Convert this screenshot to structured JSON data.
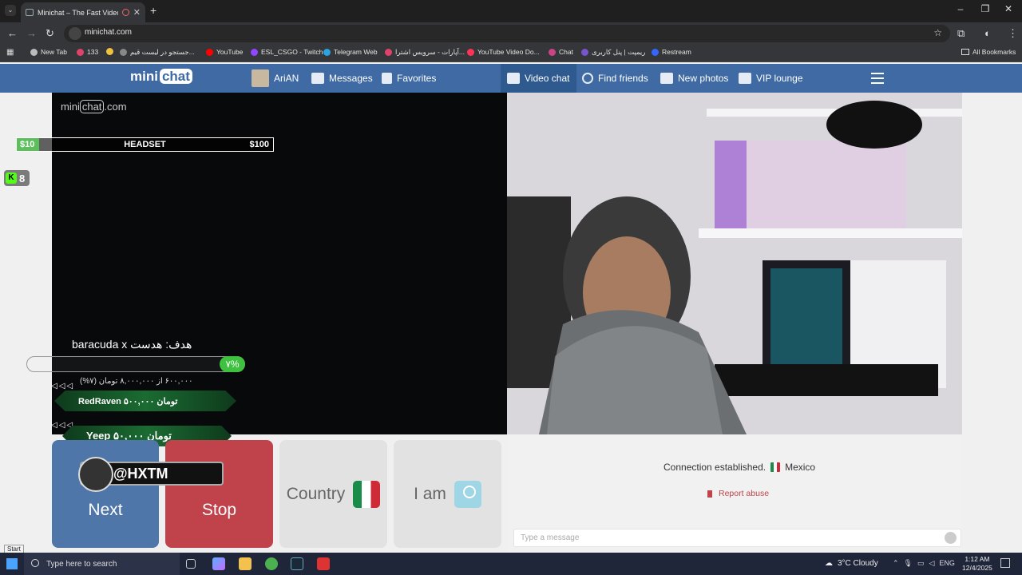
{
  "browser": {
    "tab_title": "Minichat – The Fast Video C",
    "url": "minichat.com",
    "bookmarks": [
      {
        "label": "New Tab",
        "color": "#bbbbbb"
      },
      {
        "label": "133",
        "color": "#e0426a"
      },
      {
        "label": "",
        "color": "#f0c040"
      },
      {
        "label": "جستجو در لیست قیم...",
        "color": "#888888"
      },
      {
        "label": "YouTube",
        "color": "#ff0000"
      },
      {
        "label": "ESL_CSGO - Twitch",
        "color": "#9146ff"
      },
      {
        "label": "Telegram Web",
        "color": "#2aa3e0"
      },
      {
        "label": "آپارات - سرویس اشترا...",
        "color": "#e0426a"
      },
      {
        "label": "YouTube Video Do...",
        "color": "#ff3355"
      },
      {
        "label": "Chat",
        "color": "#cc4488"
      },
      {
        "label": "ریمپت | پنل کاربری",
        "color": "#7755cc"
      },
      {
        "label": "Restream",
        "color": "#3366ff"
      }
    ],
    "all_bookmarks_label": "All Bookmarks"
  },
  "site": {
    "logo_mini": "mini",
    "logo_chat": "chat",
    "nav": {
      "user": "AriAN",
      "messages": "Messages",
      "favorites": "Favorites",
      "video_chat": "Video chat",
      "find_friends": "Find friends",
      "new_photos": "New photos",
      "vip_lounge": "VIP lounge"
    },
    "watermark_mini": "mini",
    "watermark_chat": "chat",
    "watermark_com": ".com"
  },
  "overlay": {
    "goal_low": "$10",
    "goal_label": "HEADSET",
    "goal_high": "$100",
    "kick_count": "8",
    "donation_title": "هدف: هدست baracuda x",
    "donation_percent_label": "۷%",
    "donation_progress": 0.07,
    "donation_sub": "۶۰۰,۰۰۰ از ۸,۰۰۰,۰۰۰ تومان (۷%)",
    "alert1": "RedRaven  ۵۰۰,۰۰۰ تومان",
    "alert2": "Yeep  ۵۰,۰۰۰ تومان",
    "handle": "@HXTM"
  },
  "buttons": {
    "next": "Next",
    "stop": "Stop",
    "country": "Country",
    "iam": "I am"
  },
  "chat": {
    "status": "Connection established.",
    "country": "Mexico",
    "report": "Report abuse",
    "placeholder": "Type a message"
  },
  "taskbar": {
    "start_tooltip": "Start",
    "search_placeholder": "Type here to search",
    "weather": "3°C  Cloudy",
    "lang": "ENG",
    "time": "1:12 AM",
    "date": "12/4/2025"
  }
}
